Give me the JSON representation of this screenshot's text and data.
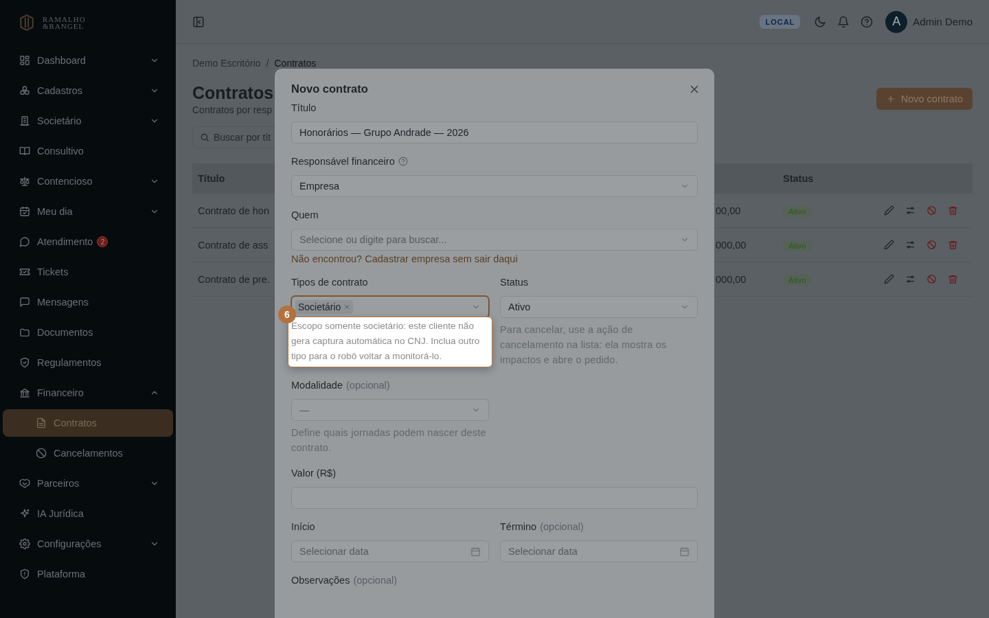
{
  "sidebar": {
    "logo": {
      "line1": "RAMALHO",
      "line2": "&RANGEL"
    },
    "items": [
      {
        "label": "Dashboard",
        "expanded": false,
        "selected": false
      },
      {
        "label": "Cadastros",
        "expanded": false,
        "selected": false
      },
      {
        "label": "Societário",
        "expanded": false,
        "selected": false
      },
      {
        "label": "Consultivo",
        "selected": false
      },
      {
        "label": "Contencioso",
        "expanded": false,
        "selected": false
      },
      {
        "label": "Meu dia",
        "expanded": false,
        "selected": false
      },
      {
        "label": "Atendimento",
        "badge": "2",
        "selected": false
      },
      {
        "label": "Tickets",
        "selected": false
      },
      {
        "label": "Mensagens",
        "selected": false
      },
      {
        "label": "Documentos",
        "selected": false
      },
      {
        "label": "Regulamentos",
        "selected": false
      },
      {
        "label": "Financeiro",
        "expanded": true,
        "selected": false,
        "children": [
          {
            "label": "Contratos",
            "selected": true
          },
          {
            "label": "Cancelamentos",
            "selected": false
          }
        ]
      },
      {
        "label": "Parceiros",
        "expanded": false,
        "selected": false
      },
      {
        "label": "IA Jurídica",
        "selected": false
      },
      {
        "label": "Configurações",
        "expanded": false,
        "selected": false
      },
      {
        "label": "Plataforma",
        "selected": false
      }
    ]
  },
  "topbar": {
    "env_badge": "LOCAL",
    "user": {
      "initial": "A",
      "name": "Admin Demo"
    }
  },
  "page": {
    "breadcrumb": [
      "Demo Escritório",
      "Contratos"
    ],
    "breadcrumb_separator": "/",
    "title": "Contratos",
    "subtitle": "Contratos por resp",
    "search": {
      "placeholder": "Buscar por tít"
    },
    "new_button": "Novo contrato",
    "table": {
      "columns": [
        "Título",
        "Status"
      ],
      "rows": [
        {
          "title": "Contrato de hon",
          "value": "00,00",
          "status": "Ativo"
        },
        {
          "title": "Contrato de ass",
          "value": "000,00",
          "status": "Ativo"
        },
        {
          "title": "Contrato de pre.",
          "value": "000,00",
          "status": "Ativo"
        }
      ]
    }
  },
  "modal": {
    "title": "Novo contrato",
    "rows": [
      {
        "fields": [
          {
            "kind": "text",
            "label": "Título",
            "value": "Honorários — Grupo Andrade — 2026"
          }
        ]
      },
      {
        "fields": [
          {
            "kind": "select",
            "label": "Responsável financeiro",
            "help_icon": true,
            "value": "Empresa"
          }
        ]
      },
      {
        "fields": [
          {
            "kind": "select",
            "label": "Quem",
            "placeholder": "Selecione ou digite para buscar...",
            "link": "Não encontrou? Cadastrar empresa sem sair daqui"
          }
        ]
      },
      {
        "fields": [
          {
            "kind": "multiselect",
            "label": "Tipos de contrato",
            "chips": [
              "Societário"
            ],
            "highlighted": true,
            "tour_step": "6",
            "hint": "Escopo somente societário: este cliente não gera captura automática no CNJ. Inclua outro tipo para o robô voltar a monitorá-lo."
          },
          {
            "kind": "select",
            "label": "Status",
            "value": "Ativo",
            "hint": "Para cancelar, use a ação de cancelamento na lista: ela mostra os impactos e abre o pedido."
          }
        ]
      },
      {
        "fields": [
          {
            "kind": "select",
            "label": "Modalidade",
            "note": "(opcional)",
            "placeholder": "—",
            "hint": "Define quais jornadas podem nascer deste contrato."
          },
          {
            "kind": "empty"
          }
        ]
      },
      {
        "fields": [
          {
            "kind": "text",
            "label": "Valor (R$)"
          }
        ]
      },
      {
        "fields": [
          {
            "kind": "date",
            "label": "Início",
            "placeholder": "Selecionar data"
          },
          {
            "kind": "date",
            "label": "Término",
            "note": "(opcional)",
            "placeholder": "Selecionar data"
          }
        ]
      },
      {
        "fields": [
          {
            "kind": "label",
            "label": "Observações",
            "note": "(opcional)"
          }
        ]
      }
    ]
  }
}
